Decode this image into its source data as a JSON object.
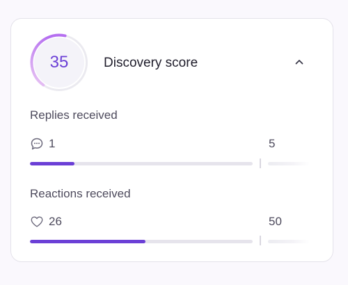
{
  "score": {
    "value": "35",
    "title": "Discovery score",
    "progress": 0.35,
    "colors": {
      "accent": "#6b3fd6",
      "ring_gradient_start": "#e9c6f3",
      "ring_gradient_end": "#b56ff0",
      "ring_track": "#ebeaf0",
      "inner": "#f4f3f9"
    },
    "collapse_icon": "chevron-up-icon"
  },
  "metrics": [
    {
      "label": "Replies received",
      "icon": "chat-bubble-icon",
      "value": "1",
      "target": "5",
      "progress": 0.2
    },
    {
      "label": "Reactions received",
      "icon": "heart-icon",
      "value": "26",
      "target": "50",
      "progress": 0.52
    }
  ]
}
